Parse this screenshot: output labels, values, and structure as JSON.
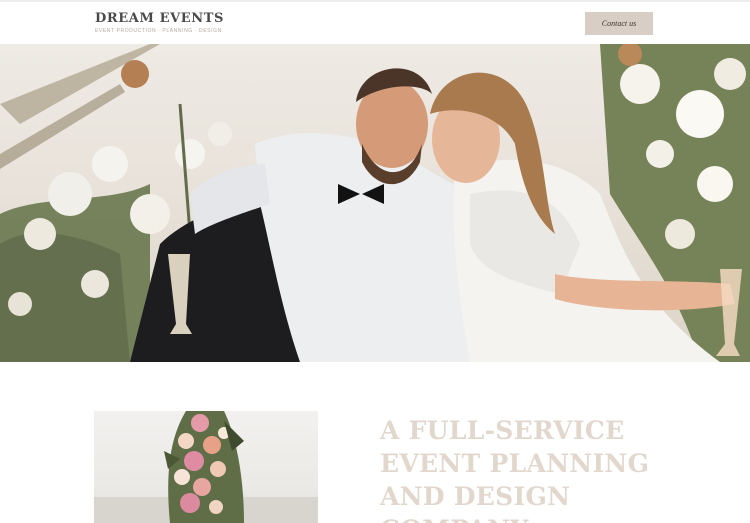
{
  "header": {
    "brand_name": "DREAM EVENTS",
    "brand_tagline": "EVENT PRODUCTION · PLANNING · DESIGN",
    "contact_label": "Contact us"
  },
  "hero": {
    "image": "couple-wedding-beach-photo"
  },
  "intro": {
    "image": "floral-arrangement-photo",
    "heading_lines": [
      "A FULL-SERVICE",
      "EVENT PLANNING",
      "AND DESIGN",
      "COMPANY"
    ]
  },
  "colors": {
    "accent": "#d9cec6",
    "heading": "#e2d7cd",
    "brand_text": "#4a4a4a"
  }
}
